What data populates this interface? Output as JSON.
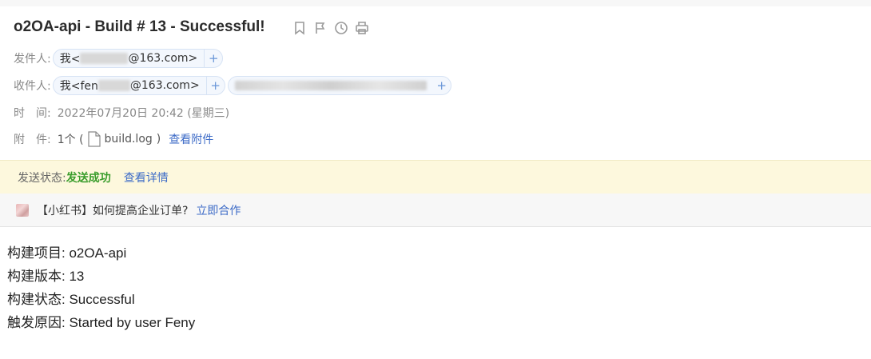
{
  "email": {
    "subject": "o2OA-api - Build # 13 - Successful!",
    "toolbar_icons": [
      "bookmark-icon",
      "flag-icon",
      "clock-icon",
      "print-icon"
    ],
    "sender": {
      "label": "发件人:",
      "name_prefix": "我<",
      "name_suffix": "@163.com>",
      "add": "+"
    },
    "recipient": {
      "label": "收件人:",
      "name_prefix": "我<fen",
      "name_suffix": "@163.com>",
      "add": "+",
      "extra_add": "+"
    },
    "time": {
      "label": "时　间:",
      "value": "2022年07月20日 20:42 (星期三)"
    },
    "attachment": {
      "label": "附　件:",
      "count": "1个 (",
      "file": "build.log",
      "close": ")",
      "view_link": "查看附件"
    }
  },
  "status_bar": {
    "label": "发送状态:",
    "status": "发送成功",
    "details_link": "查看详情",
    "status_color": "#3a9d2c"
  },
  "ad_bar": {
    "text": "【小红书】如何提高企业订单?",
    "link": "立即合作"
  },
  "body": {
    "lines": [
      "构建项目: o2OA-api",
      "构建版本: 13",
      "构建状态: Successful",
      "触发原因:  Started by user Feny"
    ]
  },
  "colors": {
    "link": "#3d6bc7",
    "status_bar_bg": "#fdf8dd",
    "chip_bg": "#f3f7fd"
  }
}
